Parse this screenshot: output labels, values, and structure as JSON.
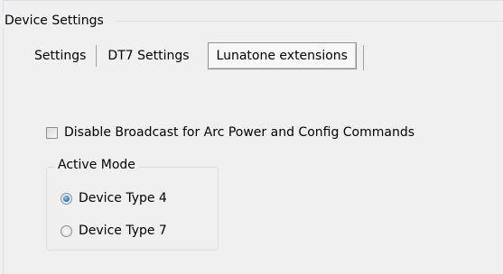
{
  "group": {
    "title": "Device Settings"
  },
  "tabs": [
    {
      "label": "Settings",
      "active": false
    },
    {
      "label": "DT7 Settings",
      "active": false
    },
    {
      "label": "Lunatone extensions",
      "active": true
    }
  ],
  "options": {
    "disable_broadcast": {
      "label": "Disable Broadcast for Arc Power and Config Commands",
      "checked": false
    }
  },
  "active_mode": {
    "title": "Active Mode",
    "choices": [
      {
        "label": "Device Type 4",
        "selected": true
      },
      {
        "label": "Device Type 7",
        "selected": false
      }
    ]
  }
}
